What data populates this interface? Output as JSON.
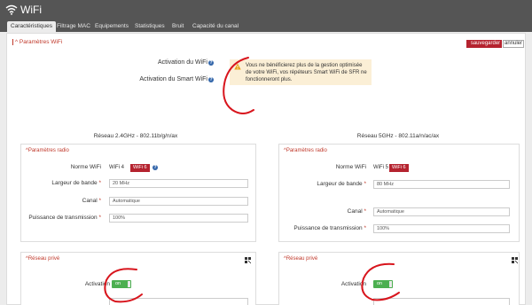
{
  "app": {
    "title": "WiFi"
  },
  "tabs": [
    {
      "label": "Caractéristiques",
      "active": true
    },
    {
      "label": "Filtrage MAC"
    },
    {
      "label": "Equipements"
    },
    {
      "label": "Statistiques"
    },
    {
      "label": "Bruit"
    },
    {
      "label": "Capacité du canal"
    }
  ],
  "params": {
    "section_title": "^ Paramètres WiFi",
    "save_label": "sauvegarder",
    "cancel_label": "annuler",
    "wifi_activation_label": "Activation du WiFi",
    "wifi_activation_state": "on",
    "smart_wifi_label": "Activation du Smart WiFi",
    "smart_wifi_state": "off",
    "warning_text": "Vous ne bénéficierez plus de la gestion optimisée de votre WiFi, vos répéteurs Smart WiFi de SFR ne fonctionneront plus."
  },
  "net24": {
    "title": "Réseau 2.4GHz - 802.11b/g/n/ax",
    "radio_title": "^Paramètres radio",
    "norme_label": "Norme WiFi",
    "norme_text": "WiFi 4",
    "norme_tag": "WiFi 6",
    "bandwidth_label": "Largeur de bande",
    "bandwidth_value": "20 MHz",
    "channel_label": "Canal",
    "channel_value": "Automatique",
    "power_label": "Puissance de transmission",
    "power_value": "100%",
    "private_title": "^Réseau privé",
    "activation_label": "Activation",
    "activation_state": "on"
  },
  "net5": {
    "title": "Réseau 5GHz - 802.11a/n/ac/ax",
    "radio_title": "^Paramètres radio",
    "norme_label": "Norme WiFi",
    "norme_text": "WiFi 5",
    "norme_tag": "WiFi 6",
    "bandwidth_label": "Largeur de bande",
    "bandwidth_value": "80 MHz",
    "channel_label": "Canal",
    "channel_value": "Automatique",
    "power_label": "Puissance de transmission",
    "power_value": "100%",
    "private_title": "^Réseau privé",
    "activation_label": "Activation",
    "activation_state": "on"
  },
  "colors": {
    "accent": "#b5232f",
    "toggle_on": "#4caf50",
    "warning_bg": "#fbefd6",
    "header_bg": "#555555"
  }
}
